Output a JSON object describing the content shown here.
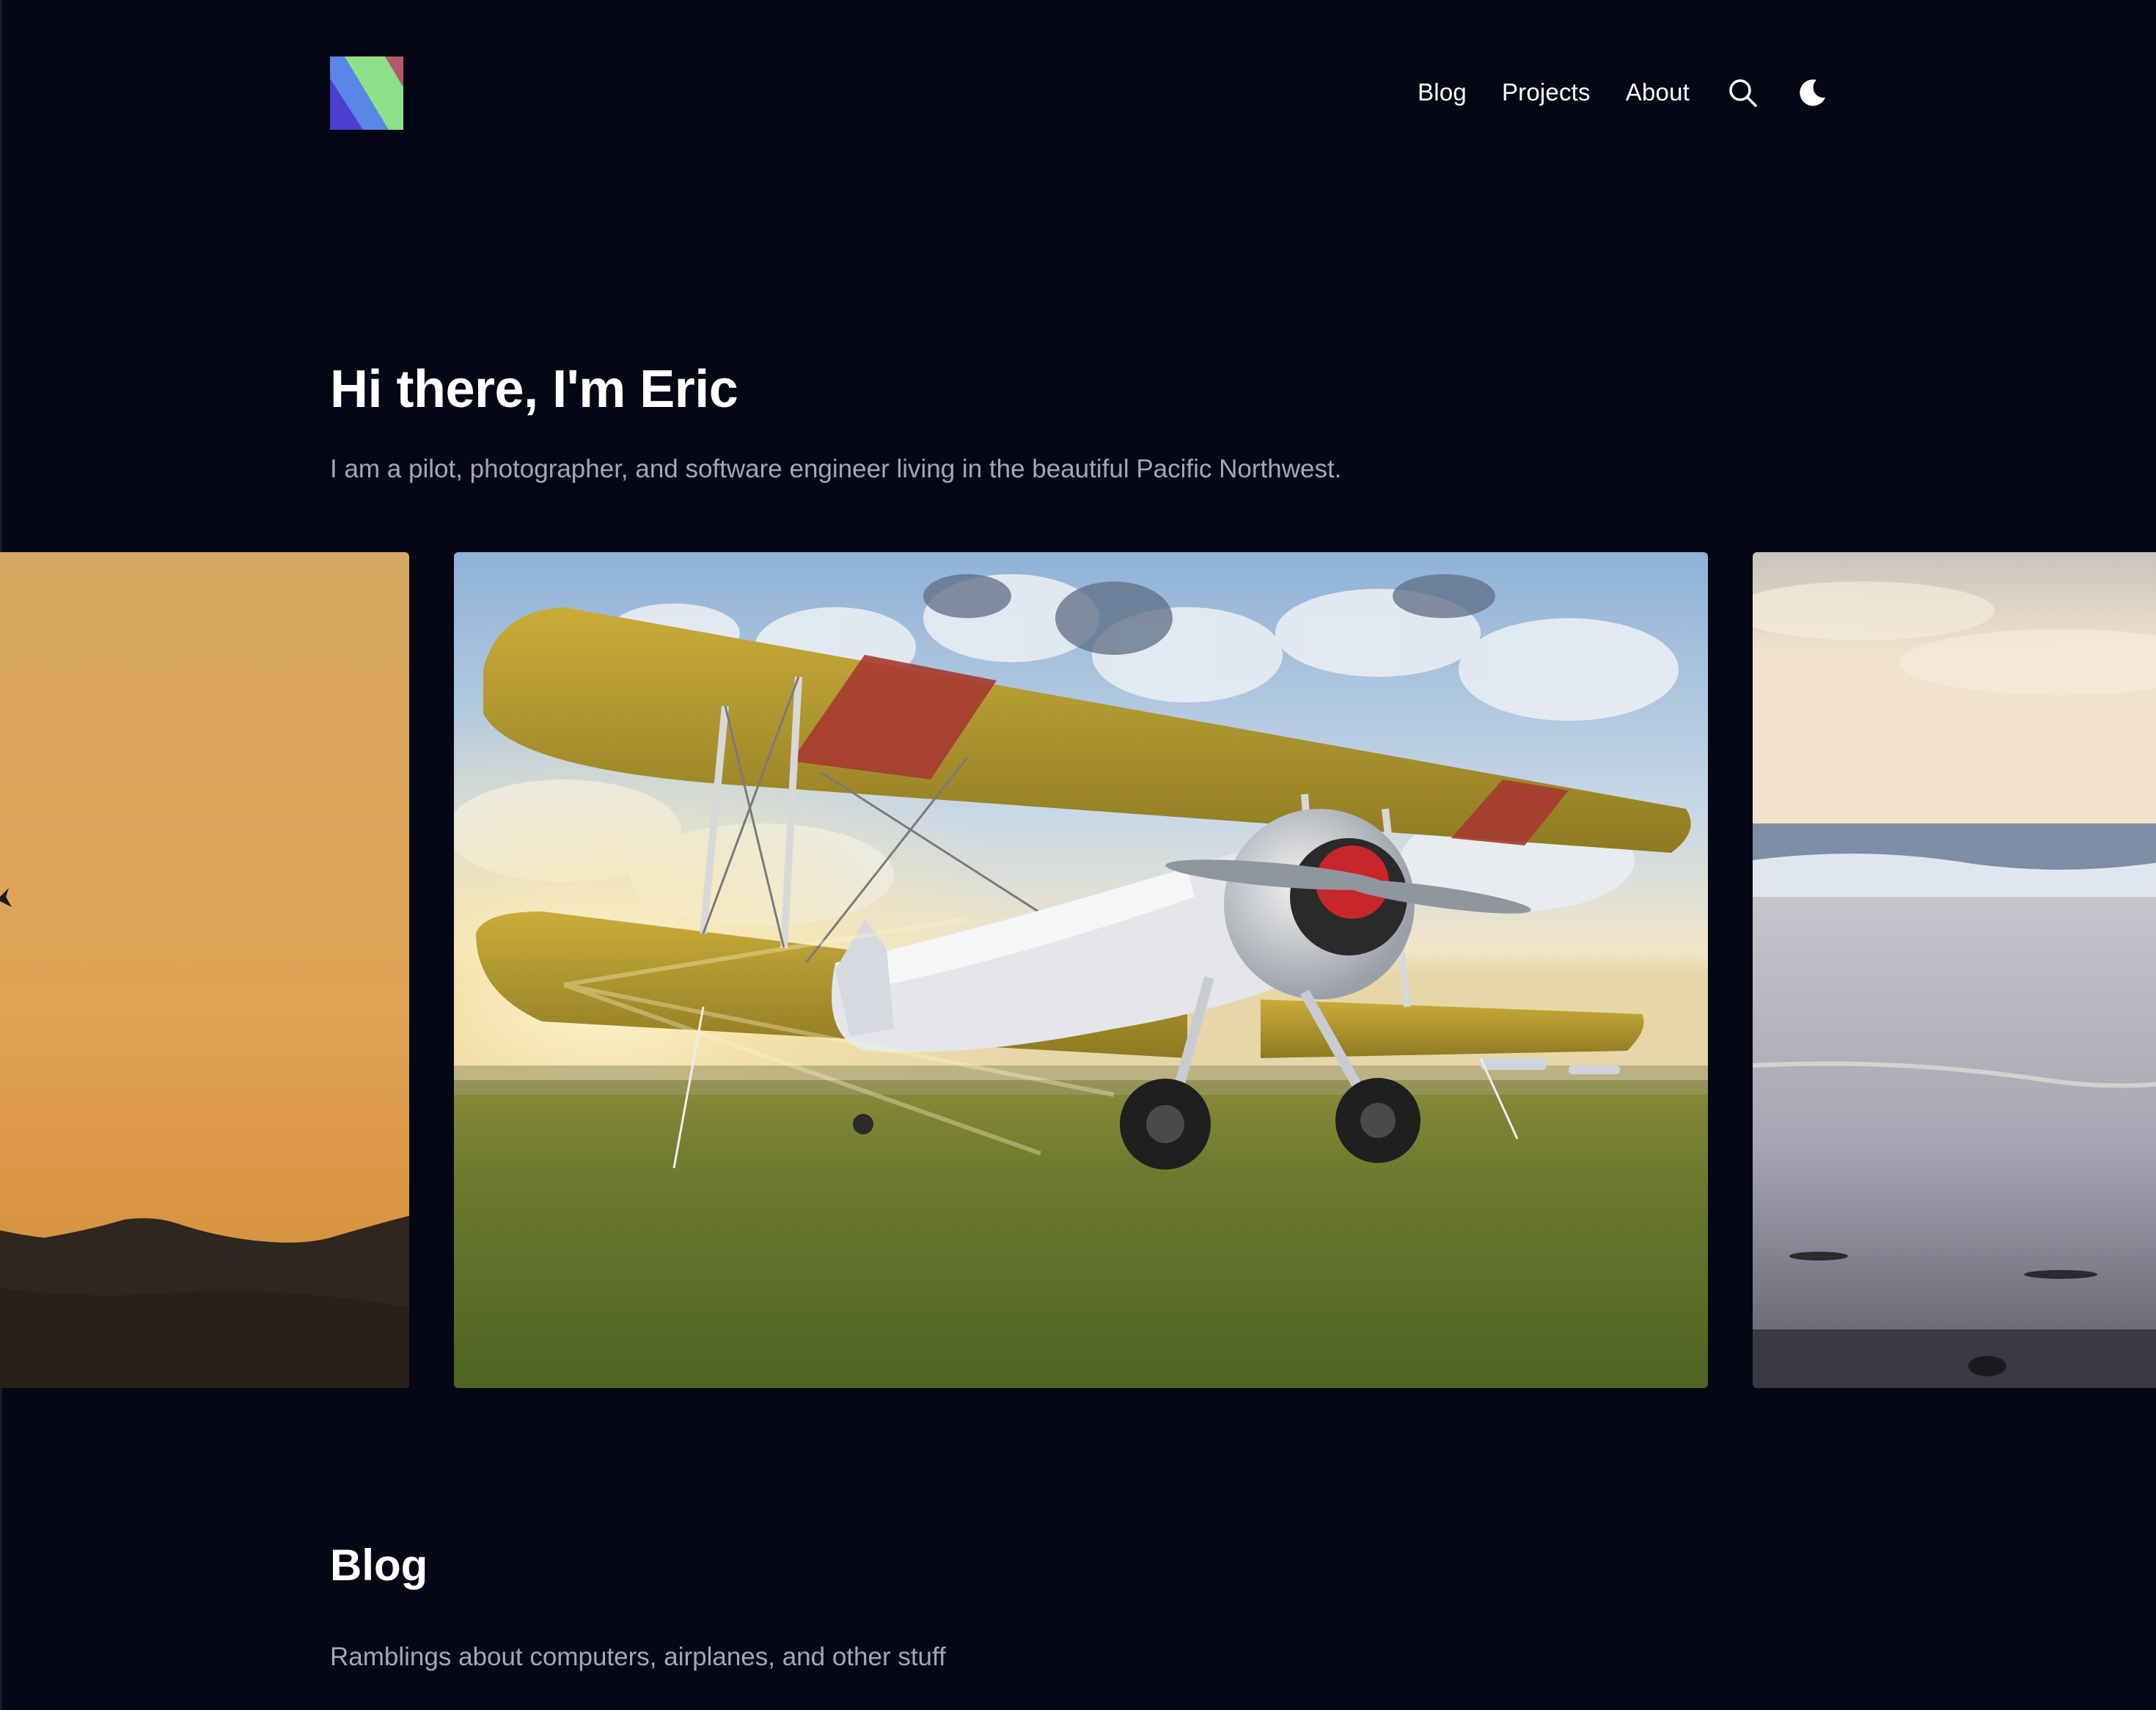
{
  "header": {
    "logo_icon": "site-logo-stripes",
    "nav": [
      {
        "label": "Blog"
      },
      {
        "label": "Projects"
      },
      {
        "label": "About"
      }
    ],
    "search_icon": "search-icon",
    "theme_icon": "moon-icon"
  },
  "hero": {
    "title": "Hi there, I'm Eric",
    "subtitle": "I am a pilot, photographer, and software engineer living in the beautiful Pacific Northwest."
  },
  "carousel": {
    "slides": [
      {
        "subject": "sunset-mountain-silhouette"
      },
      {
        "subject": "yellow-biplane-on-grass"
      },
      {
        "subject": "beach-shoreline"
      }
    ]
  },
  "blog": {
    "title": "Blog",
    "subtitle": "Ramblings about computers, airplanes, and other stuff"
  },
  "colors": {
    "background": "#050814",
    "text": "#ffffff",
    "muted": "#a3a8b8",
    "logo": [
      "#4a3fd0",
      "#5a86e8",
      "#8ce08a",
      "#b05a6a"
    ]
  }
}
